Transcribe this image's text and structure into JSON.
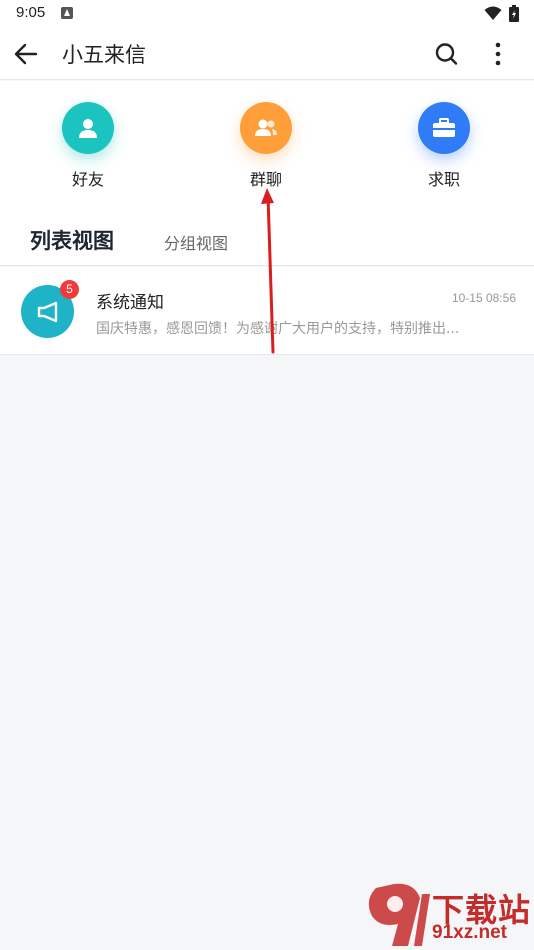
{
  "status_bar": {
    "time": "9:05"
  },
  "app_bar": {
    "title": "小五来信"
  },
  "quick_actions": [
    {
      "label": "好友",
      "color": "#1cc4c0",
      "icon": "person-icon"
    },
    {
      "label": "群聊",
      "color": "#ff9f3a",
      "icon": "group-icon"
    },
    {
      "label": "求职",
      "color": "#2f7cf6",
      "icon": "briefcase-icon"
    }
  ],
  "tabs": [
    {
      "label": "列表视图",
      "active": true
    },
    {
      "label": "分组视图",
      "active": false
    }
  ],
  "messages": [
    {
      "title": "系统通知",
      "time": "10-15 08:56",
      "preview": "国庆特惠，感恩回馈！为感谢广大用户的支持，特别推出...",
      "badge": "5",
      "icon": "speaker-icon"
    }
  ],
  "watermark": {
    "line1": "下载站",
    "line2": "91xz.net"
  },
  "colors": {
    "accent_red": "#f23a3a",
    "system_avatar": "#1eb3c6",
    "annotation_arrow": "#d81e1e"
  }
}
